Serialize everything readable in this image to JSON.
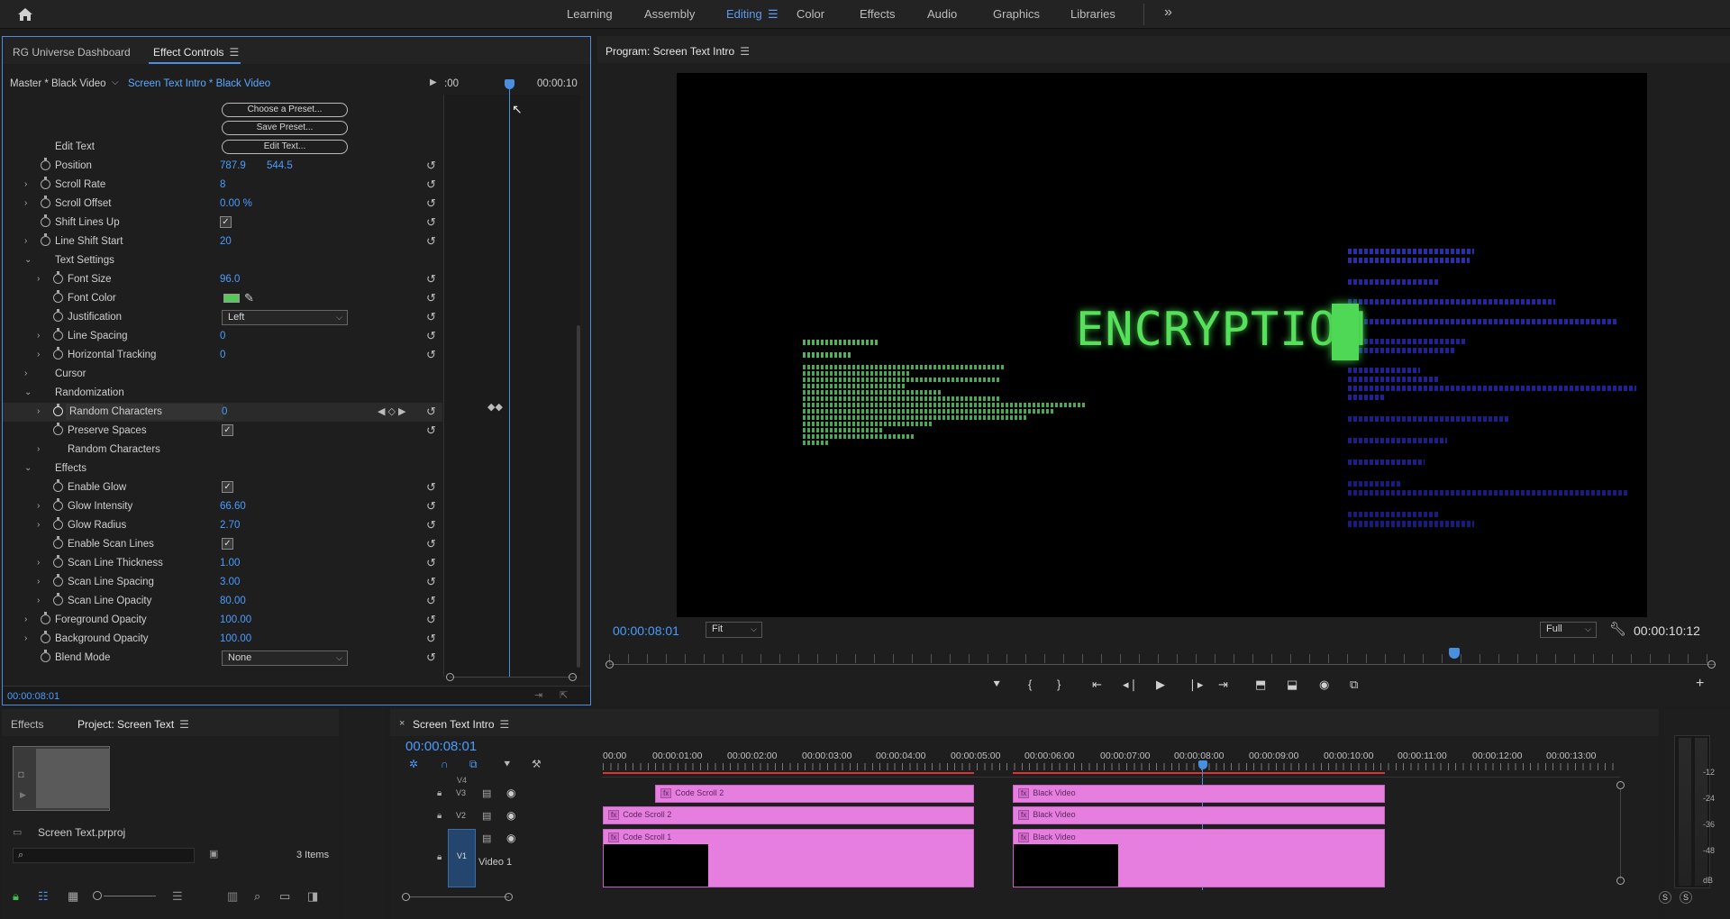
{
  "workspaces": {
    "items": [
      "Learning",
      "Assembly",
      "Editing",
      "Color",
      "Effects",
      "Audio",
      "Graphics",
      "Libraries"
    ],
    "active": "Editing",
    "more": "»"
  },
  "effect_controls": {
    "tabs": [
      "RG Universe Dashboard",
      "Effect Controls"
    ],
    "master_label": "Master * Black Video",
    "sequence_label": "Screen Text Intro * Black Video",
    "ruler_start": ":00",
    "ruler_end": "00:00:10",
    "buttons": [
      "Choose a Preset...",
      "Save Preset...",
      "Edit Text..."
    ],
    "edit_text_label": "Edit Text",
    "rows": [
      {
        "label": "Position",
        "value": "787.9",
        "value2": "544.5"
      },
      {
        "label": "Scroll Rate",
        "value": "8"
      },
      {
        "label": "Scroll Offset",
        "value": "0.00 %"
      },
      {
        "label": "Shift Lines Up",
        "check": "✓"
      },
      {
        "label": "Line Shift Start",
        "value": "20"
      },
      {
        "label": "Text Settings"
      },
      {
        "label": "Font Size",
        "value": "96.0"
      },
      {
        "label": "Font Color"
      },
      {
        "label": "Justification",
        "dropdown": "Left"
      },
      {
        "label": "Line Spacing",
        "value": "0"
      },
      {
        "label": "Horizontal Tracking",
        "value": "0"
      },
      {
        "label": "Cursor"
      },
      {
        "label": "Randomization"
      },
      {
        "label": "Random Characters",
        "value": "0"
      },
      {
        "label": "Preserve Spaces",
        "check": "✓"
      },
      {
        "label": "Random Characters"
      },
      {
        "label": "Effects"
      },
      {
        "label": "Enable Glow",
        "check": "✓"
      },
      {
        "label": "Glow Intensity",
        "value": "66.60"
      },
      {
        "label": "Glow Radius",
        "value": "2.70"
      },
      {
        "label": "Enable Scan Lines",
        "check": "✓"
      },
      {
        "label": "Scan Line Thickness",
        "value": "1.00"
      },
      {
        "label": "Scan Line Spacing",
        "value": "3.00"
      },
      {
        "label": "Scan Line Opacity",
        "value": "80.00"
      },
      {
        "label": "Foreground Opacity",
        "value": "100.00"
      },
      {
        "label": "Background Opacity",
        "value": "100.00"
      },
      {
        "label": "Blend Mode",
        "dropdown": "None"
      }
    ],
    "timecode": "00:00:08:01"
  },
  "program": {
    "title": "Program: Screen Text Intro",
    "timecode": "00:00:08:01",
    "fit": "Fit",
    "quality": "Full",
    "duration": "00:00:10:12",
    "headline": "ENCRYPTION",
    "green_color": "#56e05c"
  },
  "project": {
    "tabs": [
      "Effects",
      "Project: Screen Text"
    ],
    "file": "Screen Text.prproj",
    "items": "3 Items"
  },
  "timeline": {
    "title": "Screen Text Intro",
    "timecode": "00:00:08:01",
    "ruler": [
      "00:00",
      "00:00:01:00",
      "00:00:02:00",
      "00:00:03:00",
      "00:00:04:00",
      "00:00:05:00",
      "00:00:06:00",
      "00:00:07:00",
      "00:00:08:00",
      "00:00:09:00",
      "00:00:10:00",
      "00:00:11:00",
      "00:00:12:00",
      "00:00:13:00"
    ],
    "tracks": [
      "V4",
      "V3",
      "V2",
      "V1"
    ],
    "v1_name": "Video 1",
    "clips": [
      "Code Scroll 2",
      "Black Video",
      "Code Scroll 2",
      "Black Video",
      "Code Scroll 1",
      "Black Video"
    ],
    "clip_color": "#e67ee0"
  },
  "meter": {
    "labels": [
      "-12",
      "-24",
      "-36",
      "-48",
      "dB"
    ],
    "solo": [
      "S",
      "S"
    ]
  }
}
